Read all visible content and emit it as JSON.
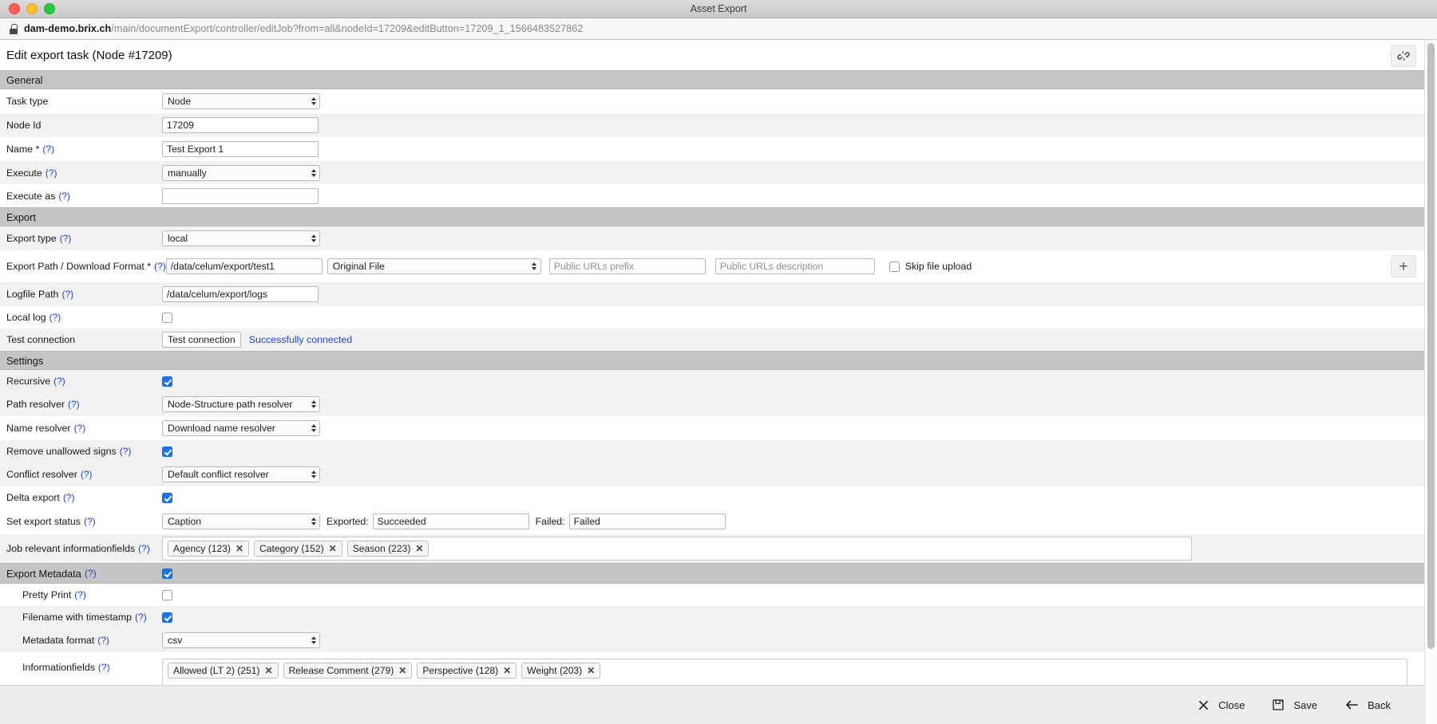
{
  "window": {
    "title": "Asset Export"
  },
  "urlbar": {
    "lock_icon": "lock-icon",
    "host": "dam-demo.brix.ch",
    "path": "/main/documentExport/controller/editJob?from=all&nodeId=17209&editButton=17209_1_1566483527862"
  },
  "header": {
    "title": "Edit export task (Node #17209)",
    "link_button_icon": "broken-link-icon"
  },
  "sections": {
    "general": "General",
    "export": "Export",
    "settings": "Settings",
    "export_metadata": "Export Metadata"
  },
  "hint_marker": "(?)",
  "fields": {
    "task_type": {
      "label": "Task type",
      "value": "Node"
    },
    "node_id": {
      "label": "Node Id",
      "value": "17209"
    },
    "name": {
      "label": "Name *",
      "value": "Test Export 1"
    },
    "execute": {
      "label": "Execute",
      "value": "manually"
    },
    "execute_as": {
      "label": "Execute as",
      "value": "",
      "placeholder": ""
    },
    "export_type": {
      "label": "Export type",
      "value": "local"
    },
    "export_path": {
      "label": "Export Path / Download Format *",
      "path_value": "/data/celum/export/test1",
      "format_value": "Original File",
      "prefix_placeholder": "Public URLs prefix",
      "prefix_value": "",
      "description_placeholder": "Public URLs description",
      "description_value": "",
      "skip_label": "Skip file upload",
      "skip_checked": false,
      "add_button": "+"
    },
    "logfile_path": {
      "label": "Logfile Path",
      "value": "/data/celum/export/logs"
    },
    "local_log": {
      "label": "Local log",
      "checked": false
    },
    "test_connection": {
      "label": "Test connection",
      "button": "Test connection",
      "status": "Successfully connected"
    },
    "recursive": {
      "label": "Recursive",
      "checked": true
    },
    "path_resolver": {
      "label": "Path resolver",
      "value": "Node-Structure path resolver"
    },
    "name_resolver": {
      "label": "Name resolver",
      "value": "Download name resolver"
    },
    "remove_unallowed_signs": {
      "label": "Remove unallowed signs",
      "checked": true
    },
    "conflict_resolver": {
      "label": "Conflict resolver",
      "value": "Default conflict resolver"
    },
    "delta_export": {
      "label": "Delta export",
      "checked": true
    },
    "set_export_status": {
      "label": "Set export status",
      "value": "Caption",
      "exported_label": "Exported:",
      "exported_value": "Succeeded",
      "failed_label": "Failed:",
      "failed_value": "Failed"
    },
    "job_relevant_informationfields": {
      "label": "Job relevant informationfields",
      "tags": [
        "Agency (123)",
        "Category (152)",
        "Season (223)"
      ]
    },
    "export_metadata": {
      "label": "Export Metadata",
      "checked": true
    },
    "pretty_print": {
      "label": "Pretty Print",
      "checked": false
    },
    "filename_with_timestamp": {
      "label": "Filename with timestamp",
      "checked": true
    },
    "metadata_format": {
      "label": "Metadata format",
      "value": "csv"
    },
    "informationfields": {
      "label": "Informationfields",
      "tags": [
        "Allowed (LT 2) (251)",
        "Release Comment (279)",
        "Perspective (128)",
        "Weight (203)"
      ]
    }
  },
  "select_options": {
    "task_type": [
      "Node"
    ],
    "execute": [
      "manually"
    ],
    "export_type": [
      "local"
    ],
    "format": [
      "Original File"
    ],
    "path_resolver": [
      "Node-Structure path resolver"
    ],
    "name_resolver": [
      "Download name resolver"
    ],
    "conflict_resolver": [
      "Default conflict resolver"
    ],
    "set_export_status": [
      "Caption"
    ],
    "metadata_format": [
      "csv"
    ]
  },
  "footer": {
    "close": "Close",
    "save": "Save",
    "back": "Back",
    "close_icon": "close-x-icon",
    "save_icon": "floppy-disk-icon",
    "back_icon": "arrow-left-icon"
  },
  "colors": {
    "section_header": "#c4c4c4",
    "row_alt": "#f2f2f2",
    "accent": "#1a74e8",
    "link": "#2244cc"
  }
}
